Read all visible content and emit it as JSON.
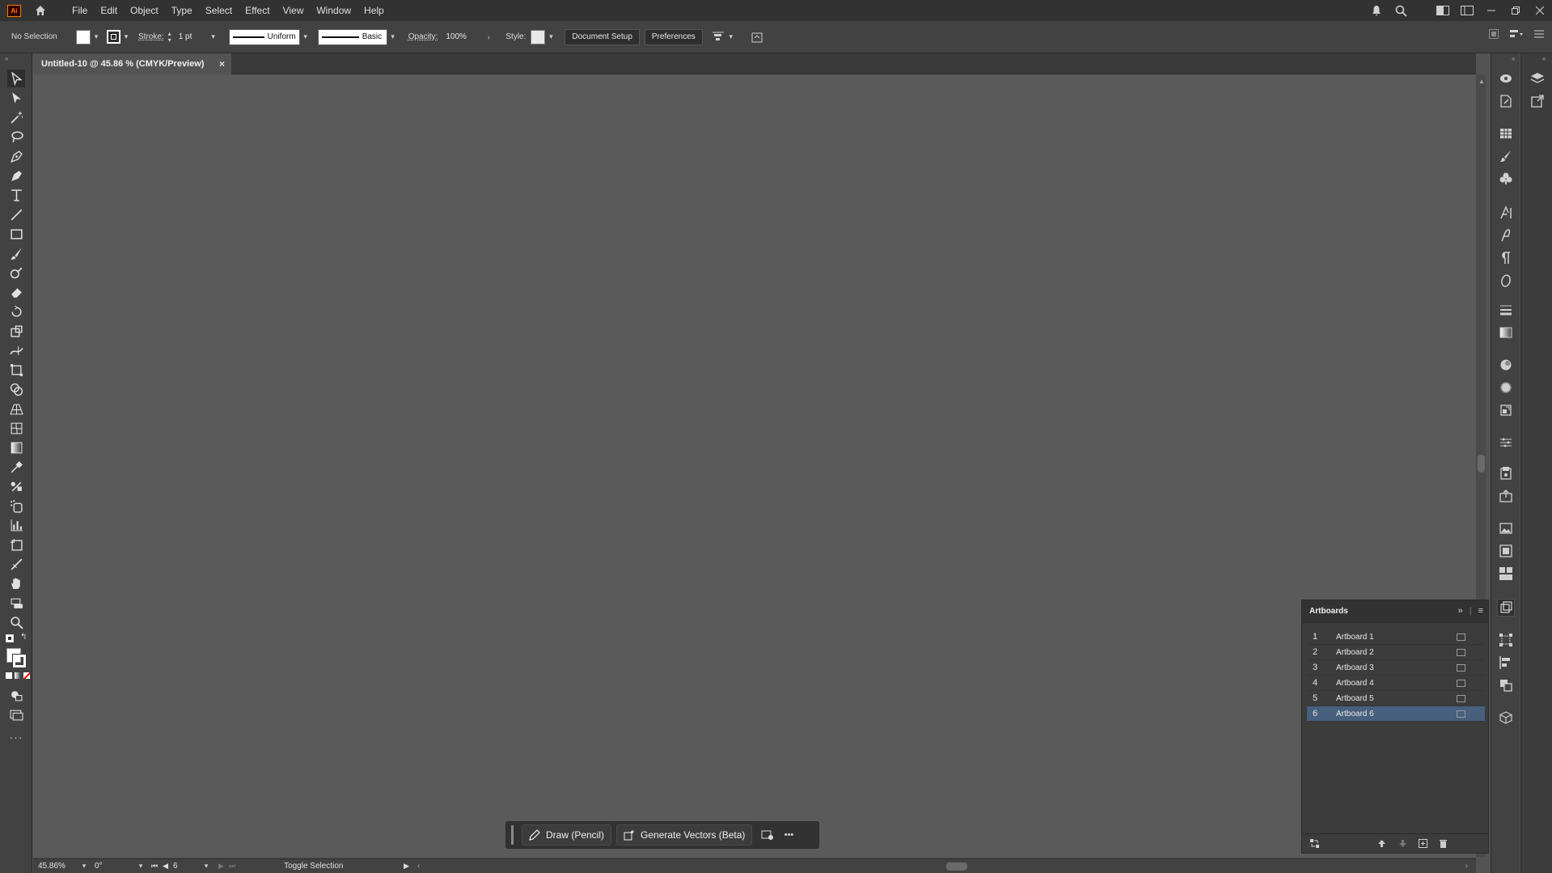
{
  "app": {
    "logo_text": "Ai"
  },
  "menu": [
    "File",
    "Edit",
    "Object",
    "Type",
    "Select",
    "Effect",
    "View",
    "Window",
    "Help"
  ],
  "control_bar": {
    "selection_label": "No Selection",
    "stroke_label": "Stroke:",
    "stroke_value": "1 pt",
    "stroke_profile": "Uniform",
    "brush": "Basic",
    "opacity_label": "Opacity:",
    "opacity_value": "100%",
    "style_label": "Style:",
    "document_setup": "Document Setup",
    "preferences": "Preferences"
  },
  "document": {
    "tab_title": "Untitled-10 @ 45.86 % (CMYK/Preview)",
    "close_glyph": "×"
  },
  "artboards_panel": {
    "title": "Artboards",
    "rows": [
      {
        "num": "1",
        "name": "Artboard 1"
      },
      {
        "num": "2",
        "name": "Artboard 2"
      },
      {
        "num": "3",
        "name": "Artboard 3"
      },
      {
        "num": "4",
        "name": "Artboard 4"
      },
      {
        "num": "5",
        "name": "Artboard 5"
      },
      {
        "num": "6",
        "name": "Artboard 6"
      }
    ],
    "selected_row": 6
  },
  "taskbar": {
    "draw_pencil": "Draw (Pencil)",
    "generate_vectors": "Generate Vectors (Beta)",
    "more": "•••"
  },
  "status_bar": {
    "zoom": "45.86%",
    "rotation": "0°",
    "artboard_number": "6",
    "tool_hint": "Toggle Selection"
  },
  "colors": {
    "accent_selected": "#46607e",
    "canvas": "#5a5a5a"
  }
}
